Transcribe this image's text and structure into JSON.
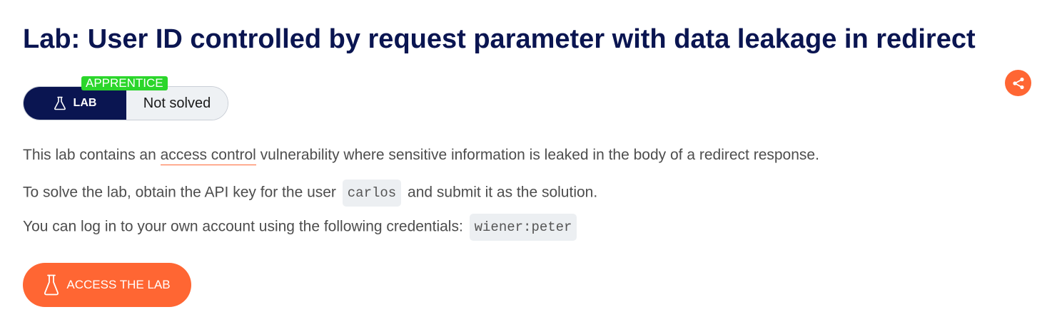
{
  "lab": {
    "title": "Lab: User ID controlled by request parameter with data leakage in redirect",
    "level_badge": "APPRENTICE",
    "type_label": "LAB",
    "status_label": "Not solved"
  },
  "description": {
    "line1_before": "This lab contains an ",
    "line1_link": "access control",
    "line1_after": " vulnerability where sensitive information is leaked in the body of a redirect response.",
    "line2_before": "To solve the lab, obtain the API key for the user ",
    "line2_code": "carlos",
    "line2_after": " and submit it as the solution.",
    "line3_before": "You can log in to your own account using the following credentials: ",
    "line3_code": "wiener:peter"
  },
  "actions": {
    "access_label": "ACCESS THE LAB"
  },
  "icons": {
    "share": "share-icon",
    "flask": "flask-icon"
  },
  "colors": {
    "title": "#0a1551",
    "accent": "#ff6633",
    "badge": "#2bd62b",
    "lab_pill": "#0a1551",
    "status_pill": "#eef1f4"
  }
}
